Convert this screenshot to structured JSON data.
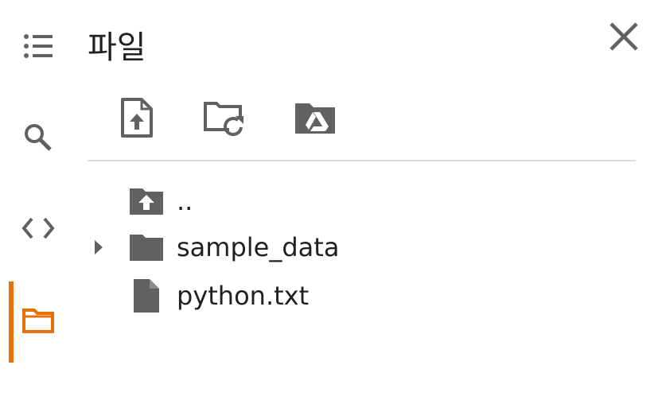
{
  "panel": {
    "title": "파일",
    "close_icon": "close-icon"
  },
  "rail": {
    "items": [
      {
        "name": "table-of-contents",
        "icon": "list-icon",
        "active": false
      },
      {
        "name": "search",
        "icon": "search-icon",
        "active": false
      },
      {
        "name": "code-snippets",
        "icon": "code-icon",
        "active": false
      },
      {
        "name": "files",
        "icon": "folder-icon",
        "active": true
      }
    ],
    "active_color": "#e8710a"
  },
  "toolbar": {
    "buttons": [
      {
        "name": "upload-file",
        "icon": "file-upload-icon"
      },
      {
        "name": "refresh",
        "icon": "folder-refresh-icon"
      },
      {
        "name": "mount-drive",
        "icon": "drive-folder-icon"
      }
    ]
  },
  "files": {
    "items": [
      {
        "name": "..",
        "type": "parent-folder",
        "icon": "folder-up-icon"
      },
      {
        "name": "sample_data",
        "type": "folder",
        "icon": "folder-icon",
        "expandable": true,
        "expanded": false
      },
      {
        "name": "python.txt",
        "type": "file",
        "icon": "file-icon"
      }
    ]
  },
  "colors": {
    "icon": "#616161",
    "text": "#212121",
    "divider": "#dadce0"
  }
}
